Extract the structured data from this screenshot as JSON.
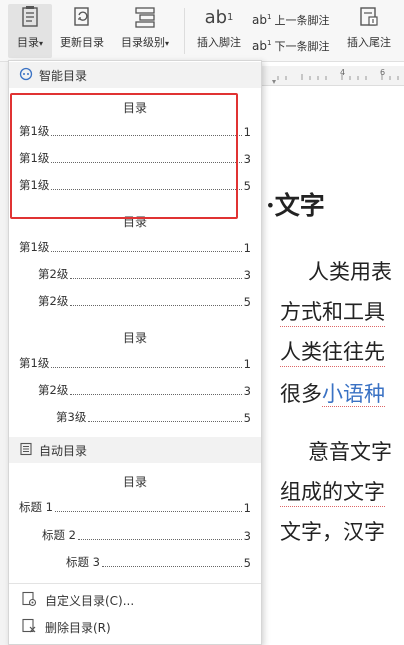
{
  "ribbon": {
    "toc_label": "目录",
    "update_toc_label": "更新目录",
    "toc_level_label": "目录级别",
    "insert_footnote_label": "插入脚注",
    "prev_footnote_label": "上一条脚注",
    "next_footnote_label": "下一条脚注",
    "insert_endnote_label": "插入尾注",
    "footnote_icon_text": "ab",
    "footnote_icon_sup": "1"
  },
  "panel": {
    "smart_section_label": "智能目录",
    "auto_section_label": "自动目录",
    "smart_cards": [
      {
        "title": "目录",
        "entries": [
          {
            "text": "第1级",
            "page": "1"
          },
          {
            "text": "第1级",
            "page": "3"
          },
          {
            "text": "第1级",
            "page": "5"
          }
        ]
      },
      {
        "title": "目录",
        "entries": [
          {
            "text": "第1级",
            "page": "1"
          },
          {
            "text": "第2级",
            "page": "3"
          },
          {
            "text": "第2级",
            "page": "5"
          }
        ]
      },
      {
        "title": "目录",
        "entries": [
          {
            "text": "第1级",
            "page": "1"
          },
          {
            "text": "第2级",
            "page": "3"
          },
          {
            "text": "第3级",
            "page": "5"
          }
        ]
      }
    ],
    "auto_card": {
      "title": "目录",
      "entries": [
        {
          "text": "标题 1",
          "page": "1"
        },
        {
          "text": "标题 2",
          "page": "3"
        },
        {
          "text": "标题 3",
          "page": "5"
        }
      ]
    },
    "custom_toc_label": "自定义目录(C)...",
    "delete_toc_label": "删除目录(R)"
  },
  "document": {
    "heading": "·文字",
    "lines": [
      "人类用表",
      "方式和工具",
      "人类往往先",
      "很多",
      "小语种",
      "意音文字",
      "组成的文字",
      "文字，汉字"
    ]
  },
  "colors": {
    "highlight": "#e03333",
    "link": "#3a72c4"
  }
}
